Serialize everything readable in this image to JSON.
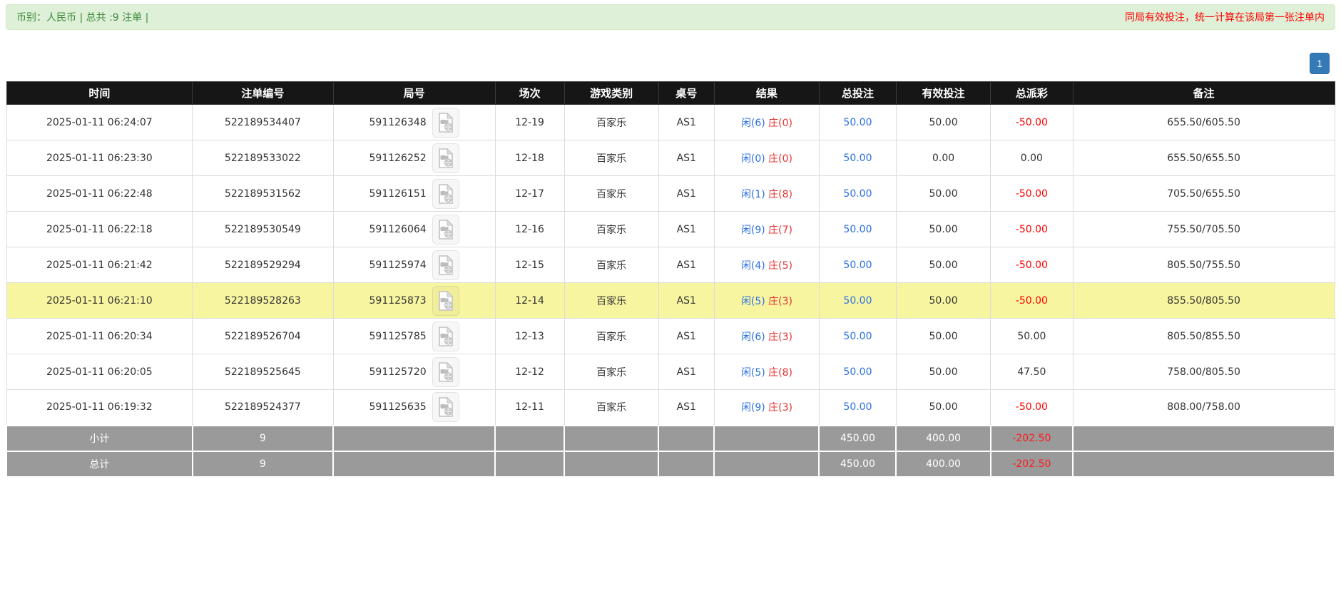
{
  "topbar": {
    "summary": "币别：人民币 | 总共 :9 注单 |",
    "notice": "同局有效投注，统一计算在该局第一张注单内"
  },
  "pagination": {
    "current_page": "1"
  },
  "icons": {
    "video_replay": "video-file-icon"
  },
  "colors": {
    "topbar_bg": "#dff0d8",
    "topbar_text": "#3d8b3d",
    "notice_red": "#ff0000",
    "pager_blue": "#337ab7",
    "header_bg": "#161616",
    "highlight_yellow": "#f8f5a1",
    "footer_gray": "#9a9a9a",
    "bet_blue": "#2b6fe0",
    "player_blue": "#2b6fe0",
    "banker_red": "#e53333",
    "negative_red": "#ff0000"
  },
  "table": {
    "headers": [
      "时间",
      "注单编号",
      "局号",
      "场次",
      "游戏类别",
      "桌号",
      "结果",
      "总投注",
      "有效投注",
      "总派彩",
      "备注"
    ],
    "rows": [
      {
        "time": "2025-01-11 06:24:07",
        "bet_id": "522189534407",
        "round": "591126348",
        "session": "12-19",
        "game": "百家乐",
        "table_no": "AS1",
        "player": "闲(6)",
        "banker": "庄(0)",
        "total_bet": "50.00",
        "valid_bet": "50.00",
        "payout": "-50.00",
        "remark": "655.50/605.50",
        "highlight": false
      },
      {
        "time": "2025-01-11 06:23:30",
        "bet_id": "522189533022",
        "round": "591126252",
        "session": "12-18",
        "game": "百家乐",
        "table_no": "AS1",
        "player": "闲(0)",
        "banker": "庄(0)",
        "total_bet": "50.00",
        "valid_bet": "0.00",
        "payout": "0.00",
        "remark": "655.50/655.50",
        "highlight": false
      },
      {
        "time": "2025-01-11 06:22:48",
        "bet_id": "522189531562",
        "round": "591126151",
        "session": "12-17",
        "game": "百家乐",
        "table_no": "AS1",
        "player": "闲(1)",
        "banker": "庄(8)",
        "total_bet": "50.00",
        "valid_bet": "50.00",
        "payout": "-50.00",
        "remark": "705.50/655.50",
        "highlight": false
      },
      {
        "time": "2025-01-11 06:22:18",
        "bet_id": "522189530549",
        "round": "591126064",
        "session": "12-16",
        "game": "百家乐",
        "table_no": "AS1",
        "player": "闲(9)",
        "banker": "庄(7)",
        "total_bet": "50.00",
        "valid_bet": "50.00",
        "payout": "-50.00",
        "remark": "755.50/705.50",
        "highlight": false
      },
      {
        "time": "2025-01-11 06:21:42",
        "bet_id": "522189529294",
        "round": "591125974",
        "session": "12-15",
        "game": "百家乐",
        "table_no": "AS1",
        "player": "闲(4)",
        "banker": "庄(5)",
        "total_bet": "50.00",
        "valid_bet": "50.00",
        "payout": "-50.00",
        "remark": "805.50/755.50",
        "highlight": false
      },
      {
        "time": "2025-01-11 06:21:10",
        "bet_id": "522189528263",
        "round": "591125873",
        "session": "12-14",
        "game": "百家乐",
        "table_no": "AS1",
        "player": "闲(5)",
        "banker": "庄(3)",
        "total_bet": "50.00",
        "valid_bet": "50.00",
        "payout": "-50.00",
        "remark": "855.50/805.50",
        "highlight": true
      },
      {
        "time": "2025-01-11 06:20:34",
        "bet_id": "522189526704",
        "round": "591125785",
        "session": "12-13",
        "game": "百家乐",
        "table_no": "AS1",
        "player": "闲(6)",
        "banker": "庄(3)",
        "total_bet": "50.00",
        "valid_bet": "50.00",
        "payout": "50.00",
        "remark": "805.50/855.50",
        "highlight": false
      },
      {
        "time": "2025-01-11 06:20:05",
        "bet_id": "522189525645",
        "round": "591125720",
        "session": "12-12",
        "game": "百家乐",
        "table_no": "AS1",
        "player": "闲(5)",
        "banker": "庄(8)",
        "total_bet": "50.00",
        "valid_bet": "50.00",
        "payout": "47.50",
        "remark": "758.00/805.50",
        "highlight": false
      },
      {
        "time": "2025-01-11 06:19:32",
        "bet_id": "522189524377",
        "round": "591125635",
        "session": "12-11",
        "game": "百家乐",
        "table_no": "AS1",
        "player": "闲(9)",
        "banker": "庄(3)",
        "total_bet": "50.00",
        "valid_bet": "50.00",
        "payout": "-50.00",
        "remark": "808.00/758.00",
        "highlight": false
      }
    ],
    "footer": [
      {
        "label": "小计",
        "count": "9",
        "total_bet": "450.00",
        "valid_bet": "400.00",
        "payout": "-202.50"
      },
      {
        "label": "总计",
        "count": "9",
        "total_bet": "450.00",
        "valid_bet": "400.00",
        "payout": "-202.50"
      }
    ]
  }
}
